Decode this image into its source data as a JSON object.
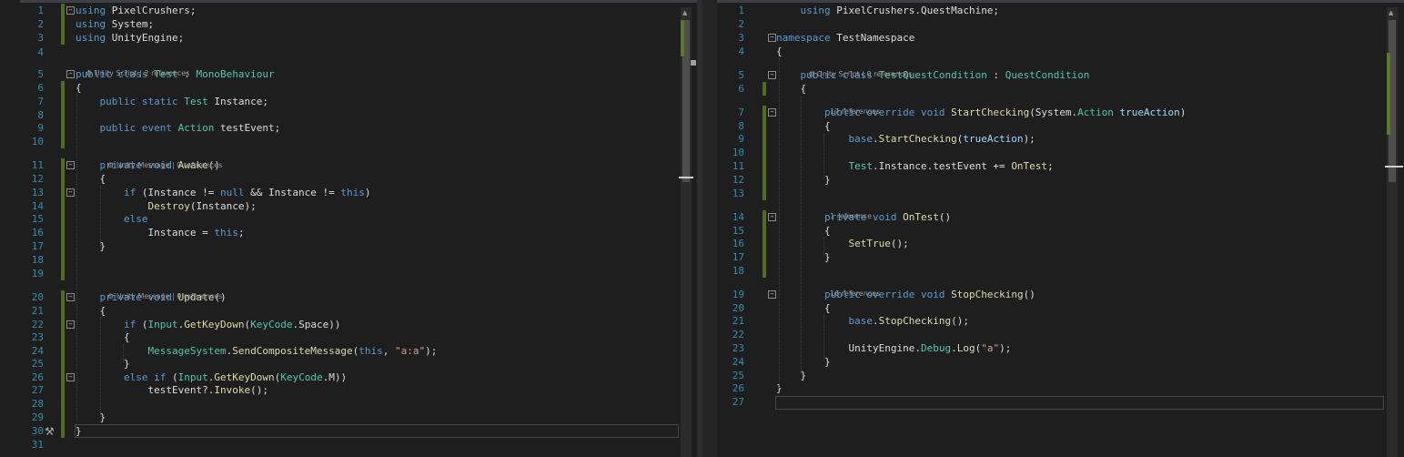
{
  "left_editor": {
    "lens_script": "Unity Script | 2 references",
    "lens_awake": "Unity Message | 0 references",
    "lens_update": "Unity Message | 0 references",
    "lines": [
      {
        "n": "1",
        "c": "<span class='kw'>using</span> PixelCrushers;"
      },
      {
        "n": "2",
        "c": "<span class='kw'>using</span> System;"
      },
      {
        "n": "3",
        "c": "<span class='kw'>using</span> UnityEngine;"
      },
      {
        "n": "4",
        "c": ""
      },
      {
        "n": "5",
        "c": "<span class='kw'>public</span> <span class='kw'>class</span> <span class='ty'>Test</span> : <span class='ty'>MonoBehaviour</span>"
      },
      {
        "n": "6",
        "c": "{"
      },
      {
        "n": "7",
        "c": "    <span class='kw'>public</span> <span class='kw'>static</span> <span class='ty'>Test</span> Instance;"
      },
      {
        "n": "8",
        "c": ""
      },
      {
        "n": "9",
        "c": "    <span class='kw'>public</span> <span class='kw'>event</span> <span class='ty'>Action</span> testEvent;"
      },
      {
        "n": "10",
        "c": ""
      },
      {
        "n": "11",
        "c": "    <span class='kw'>private</span> <span class='kw'>void</span> <span class='fn'>Awake</span>()"
      },
      {
        "n": "12",
        "c": "    {"
      },
      {
        "n": "13",
        "c": "        <span class='kw'>if</span> (Instance != <span class='kw'>null</span> &amp;&amp; Instance != <span class='kw'>this</span>)"
      },
      {
        "n": "14",
        "c": "            <span class='fn'>Destroy</span>(Instance);"
      },
      {
        "n": "15",
        "c": "        <span class='kw'>else</span>"
      },
      {
        "n": "16",
        "c": "            Instance = <span class='kw'>this</span>;"
      },
      {
        "n": "17",
        "c": "    }"
      },
      {
        "n": "18",
        "c": ""
      },
      {
        "n": "19",
        "c": ""
      },
      {
        "n": "20",
        "c": "    <span class='kw'>private</span> <span class='kw'>void</span> <span class='fn'>Update</span>()"
      },
      {
        "n": "21",
        "c": "    {"
      },
      {
        "n": "22",
        "c": "        <span class='kw'>if</span> (<span class='ty'>Input</span>.<span class='fn'>GetKeyDown</span>(<span class='ty'>KeyCode</span>.Space))"
      },
      {
        "n": "23",
        "c": "        {"
      },
      {
        "n": "24",
        "c": "            <span class='ty'>MessageSystem</span>.<span class='fn'>SendCompositeMessage</span>(<span class='kw'>this</span>, <span class='st'>\"a:a\"</span>);"
      },
      {
        "n": "25",
        "c": "        }"
      },
      {
        "n": "26",
        "c": "        <span class='kw'>else</span> <span class='kw'>if</span> (<span class='ty'>Input</span>.<span class='fn'>GetKeyDown</span>(<span class='ty'>KeyCode</span>.M))"
      },
      {
        "n": "27",
        "c": "            testEvent?.<span class='fn'>Invoke</span>();"
      },
      {
        "n": "28",
        "c": ""
      },
      {
        "n": "29",
        "c": "    }"
      },
      {
        "n": "30",
        "c": "}"
      },
      {
        "n": "31",
        "c": ""
      }
    ]
  },
  "right_editor": {
    "lens_class": "Unity Script | 0 references",
    "lens_start": "17 references",
    "lens_ontest": "1 reference",
    "lens_stop": "16 references",
    "lines": [
      {
        "n": "1",
        "c": "    <span class='kw'>using</span> PixelCrushers.QuestMachine;"
      },
      {
        "n": "2",
        "c": ""
      },
      {
        "n": "3",
        "c": "<span class='kw'>namespace</span> TestNamespace"
      },
      {
        "n": "4",
        "c": "{"
      },
      {
        "n": "5",
        "c": "    <span class='kw'>public</span> <span class='kw'>class</span> <span class='ty'>TestQuestCondition</span> : <span class='ty'>QuestCondition</span>"
      },
      {
        "n": "6",
        "c": "    {"
      },
      {
        "n": "7",
        "c": "        <span class='kw'>public</span> <span class='kw'>override</span> <span class='kw'>void</span> <span class='fn'>StartChecking</span>(System.<span class='ty'>Action</span> <span class='pm'>trueAction</span>)"
      },
      {
        "n": "8",
        "c": "        {"
      },
      {
        "n": "9",
        "c": "            <span class='kw'>base</span>.<span class='fn'>StartChecking</span>(<span class='pm'>trueAction</span>);"
      },
      {
        "n": "10",
        "c": ""
      },
      {
        "n": "11",
        "c": "            <span class='ty'>Test</span>.Instance.testEvent += <span class='fn'>OnTest</span>;"
      },
      {
        "n": "12",
        "c": "        }"
      },
      {
        "n": "13",
        "c": ""
      },
      {
        "n": "14",
        "c": "        <span class='kw'>private</span> <span class='kw'>void</span> <span class='fn'>OnTest</span>()"
      },
      {
        "n": "15",
        "c": "        {"
      },
      {
        "n": "16",
        "c": "            <span class='fn'>SetTrue</span>();"
      },
      {
        "n": "17",
        "c": "        }"
      },
      {
        "n": "18",
        "c": ""
      },
      {
        "n": "19",
        "c": "        <span class='kw'>public</span> <span class='kw'>override</span> <span class='kw'>void</span> <span class='fn'>StopChecking</span>()"
      },
      {
        "n": "20",
        "c": "        {"
      },
      {
        "n": "21",
        "c": "            <span class='kw'>base</span>.<span class='fn'>StopChecking</span>();"
      },
      {
        "n": "22",
        "c": ""
      },
      {
        "n": "23",
        "c": "            UnityEngine.<span class='ty'>Debug</span>.<span class='fn'>Log</span>(<span class='st'>\"a\"</span>);"
      },
      {
        "n": "24",
        "c": "        }"
      },
      {
        "n": "25",
        "c": "    }"
      },
      {
        "n": "26",
        "c": "}"
      },
      {
        "n": "27",
        "c": ""
      }
    ]
  }
}
